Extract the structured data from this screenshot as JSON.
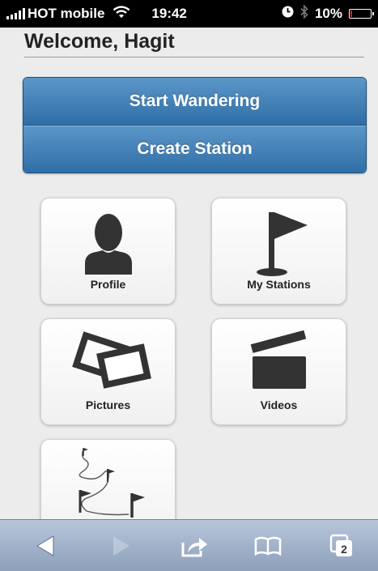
{
  "status_bar": {
    "carrier": "HOT mobile",
    "time": "19:42",
    "battery": "10%",
    "battery_level": 0.1,
    "icons": [
      "signal-bars-icon",
      "wifi-icon",
      "clock-icon",
      "bluetooth-icon",
      "battery-icon"
    ]
  },
  "header": {
    "title": "Welcome, Hagit"
  },
  "actions": [
    {
      "label": "Start Wandering"
    },
    {
      "label": "Create Station"
    }
  ],
  "tiles": [
    {
      "label": "Profile",
      "icon": "person-icon"
    },
    {
      "label": "My Stations",
      "icon": "flag-icon"
    },
    {
      "label": "Pictures",
      "icon": "photos-icon"
    },
    {
      "label": "Videos",
      "icon": "clapperboard-icon"
    },
    {
      "label": "",
      "icon": "route-flags-icon"
    }
  ],
  "toolbar": {
    "icons": [
      "back-arrow-icon",
      "forward-arrow-icon",
      "share-icon",
      "bookmarks-icon",
      "tabs-icon"
    ],
    "tabs_count": "2"
  },
  "colors": {
    "accent": "#3a78b0",
    "toolbar": "#a3b3cb",
    "background": "#ececec",
    "icon": "#333333"
  }
}
